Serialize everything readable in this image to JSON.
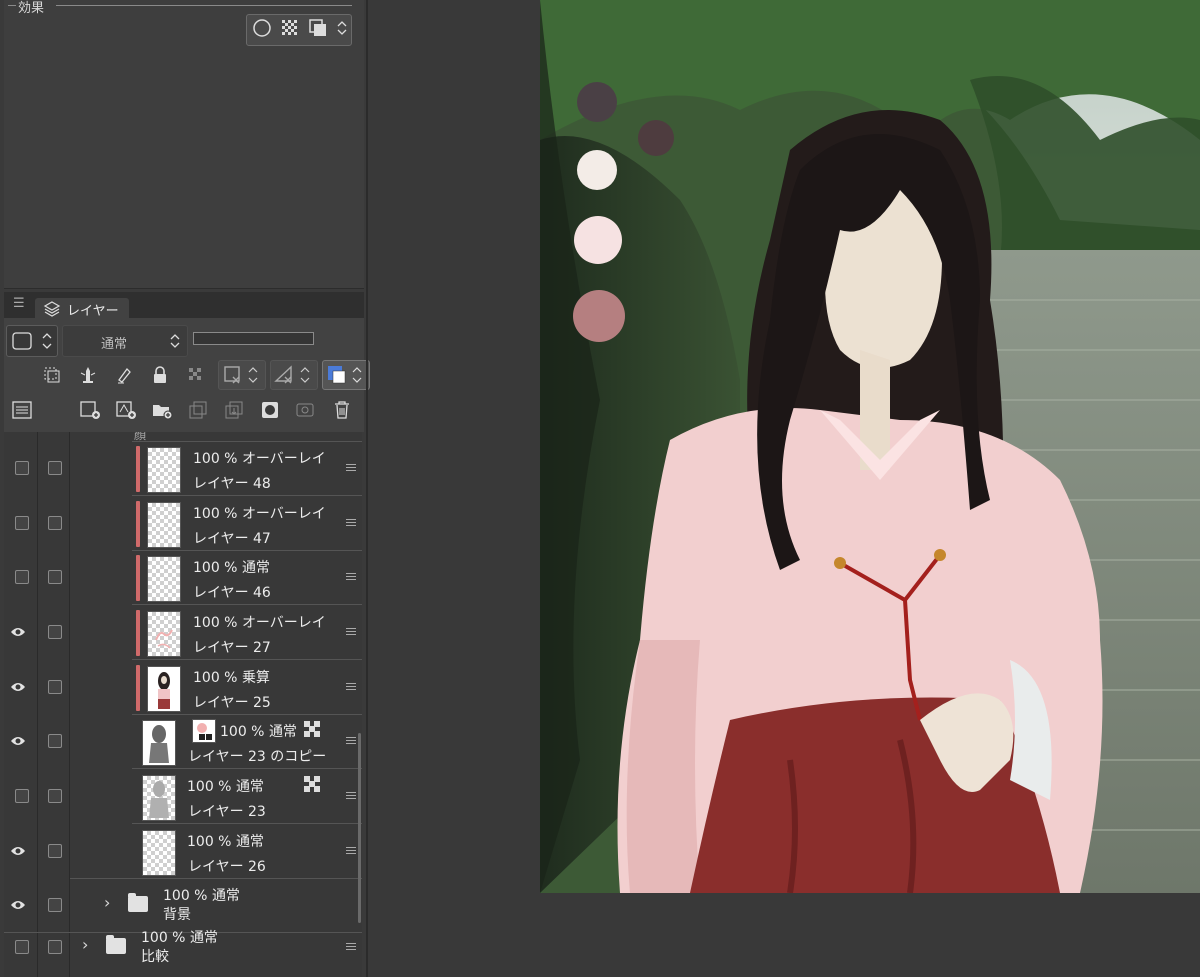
{
  "effects": {
    "title": "効果"
  },
  "layer_panel": {
    "tab_label": "レイヤー",
    "blend_mode": "通常"
  },
  "layers": [
    {
      "partial_label": "顔"
    },
    {
      "visible": false,
      "clipped": true,
      "opacity": "100 %",
      "mode": "オーバーレイ",
      "name": "レイヤー 48",
      "thumb": "empty"
    },
    {
      "visible": false,
      "clipped": true,
      "opacity": "100 %",
      "mode": "オーバーレイ",
      "name": "レイヤー 47",
      "thumb": "empty"
    },
    {
      "visible": false,
      "clipped": true,
      "opacity": "100 %",
      "mode": "通常",
      "name": "レイヤー 46",
      "thumb": "empty"
    },
    {
      "visible": true,
      "clipped": true,
      "opacity": "100 %",
      "mode": "オーバーレイ",
      "name": "レイヤー 27",
      "thumb": "sketch-pink"
    },
    {
      "visible": true,
      "clipped": true,
      "opacity": "100 %",
      "mode": "乗算",
      "name": "レイヤー 25",
      "thumb": "figure-color"
    },
    {
      "visible": true,
      "clipped": false,
      "opacity": "100 %",
      "mode": "通常",
      "name": "レイヤー 23 のコピー",
      "thumb": "figure-gray",
      "has_mask": true,
      "ref_icon": true
    },
    {
      "visible": false,
      "clipped": false,
      "opacity": "100 %",
      "mode": "通常",
      "name": "レイヤー 23",
      "thumb": "figure-silhouette",
      "ref_icon": true
    },
    {
      "visible": true,
      "clipped": false,
      "opacity": "100 %",
      "mode": "通常",
      "name": "レイヤー 26",
      "thumb": "empty-dots"
    },
    {
      "visible": true,
      "folder": true,
      "opacity": "100 %",
      "mode": "通常",
      "name": "背景"
    },
    {
      "visible": false,
      "folder": true,
      "opacity": "100 %",
      "mode": "通常",
      "name": "比較"
    }
  ],
  "colors": {
    "panel_bg": "#3a3a3a",
    "clip_indicator": "#d06a6a",
    "selected_color": "#4b7bd8"
  },
  "palette_swatches": [
    "#4a4045",
    "#4e3c3f",
    "#f3ece7",
    "#f6e2e2",
    "#b57f80"
  ]
}
